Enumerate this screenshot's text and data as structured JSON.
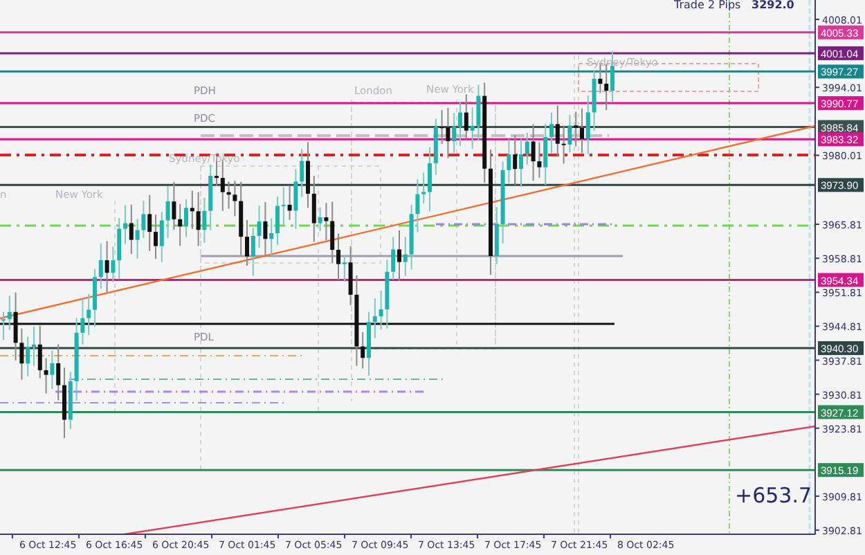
{
  "header": {
    "label": "Trade 2 Pips",
    "value": "3292.0"
  },
  "session_labels": [
    {
      "text": "Sydney/Tokyo",
      "kind": "session"
    },
    {
      "text": "PDH",
      "kind": "level"
    },
    {
      "text": "London",
      "kind": "session"
    },
    {
      "text": "New York",
      "kind": "session"
    },
    {
      "text": "PDC",
      "kind": "level"
    },
    {
      "text": "Sydney/Tokyo",
      "kind": "session"
    },
    {
      "text": "n",
      "kind": "session"
    },
    {
      "text": "New York",
      "kind": "session"
    },
    {
      "text": "PDL",
      "kind": "level"
    }
  ],
  "price_levels": [
    {
      "label": "4005.33",
      "color": "#d6389c"
    },
    {
      "label": "4001.04",
      "color": "#7a1f7e"
    },
    {
      "label": "3997.27",
      "color": "#17868a"
    },
    {
      "label": "3990.77",
      "color": "#d4178c"
    },
    {
      "label": "3985.84",
      "color": "#3c5050"
    },
    {
      "label": "3983.32",
      "color": "#d4178c"
    },
    {
      "label": "3973.90",
      "color": "#2e4646"
    },
    {
      "label": "3954.34",
      "color": "#d4178c"
    },
    {
      "label": "3940.30",
      "color": "#2e4646"
    },
    {
      "label": "3927.12",
      "color": "#2e8b57"
    },
    {
      "label": "3915.19",
      "color": "#2e8b57"
    }
  ],
  "price_axis": [
    "4008.01",
    "3994.01",
    "3980.01",
    "3965.81",
    "3958.81",
    "3951.81",
    "3944.81",
    "3937.81",
    "3930.81",
    "3923.81",
    "3909.81",
    "3902.81"
  ],
  "time_axis": [
    "6 Oct 12:45",
    "6 Oct 16:45",
    "6 Oct 20:45",
    "7 Oct 01:45",
    "7 Oct 05:45",
    "7 Oct 09:45",
    "7 Oct 13:45",
    "7 Oct 17:45",
    "7 Oct 21:45",
    "8 Oct 02:45"
  ],
  "profit": "+653.7"
}
